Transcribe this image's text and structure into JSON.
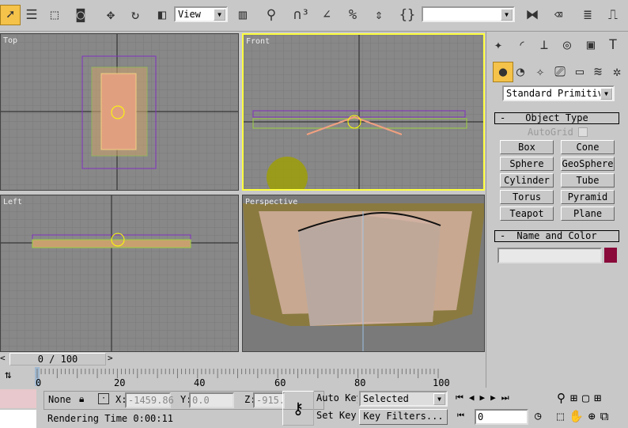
{
  "toolbar": {
    "icons": [
      "select-arrow-icon",
      "select-by-name-icon",
      "rect-selection-icon",
      "window-crossing-icon",
      "move-icon",
      "rotate-icon",
      "scale-icon",
      "mirror-tools-icon",
      "link-icon",
      "snap-3-icon",
      "angle-snap-icon",
      "percent-snap-icon",
      "spinner-snap-icon",
      "named-selection-icon",
      "mirror-icon",
      "align-icon",
      "layers-icon"
    ],
    "ref_coord": "View",
    "named_selection": ""
  },
  "viewports": [
    {
      "label": "Top"
    },
    {
      "label": "Front",
      "active": true
    },
    {
      "label": "Left"
    },
    {
      "label": "Perspective"
    }
  ],
  "panel": {
    "tabs": [
      "create-icon",
      "modify-icon",
      "hierarchy-icon",
      "motion-icon",
      "display-icon",
      "utilities-icon"
    ],
    "categories": [
      "geometry-icon",
      "shapes-icon",
      "lights-icon",
      "cameras-icon",
      "helpers-icon",
      "space-warps-icon",
      "systems-icon"
    ],
    "dropdown": "Standard Primitiv",
    "object_type": {
      "title": "Object Type",
      "autogrid": "AutoGrid",
      "buttons": [
        "Box",
        "Cone",
        "Sphere",
        "GeoSphere",
        "Cylinder",
        "Tube",
        "Torus",
        "Pyramid",
        "Teapot",
        "Plane"
      ]
    },
    "name_color": {
      "title": "Name and Color",
      "name": "",
      "color": "#8a0a3a"
    },
    "collapse": "-"
  },
  "timeline": {
    "frame": "0 / 100",
    "ticks": [
      "0",
      "20",
      "40",
      "60",
      "80",
      "100"
    ]
  },
  "status": {
    "selection": "None",
    "x_label": "X:",
    "x": "-1459.86",
    "y_label": "Y:",
    "y": "0.0",
    "z_label": "Z:",
    "z": "-915.",
    "rendering": "Rendering Time  0:00:11",
    "auto_key": "Auto Key",
    "set_key": "Set Key",
    "key_mode": "Selected",
    "key_filters": "Key Filters...",
    "current_frame": "0"
  }
}
